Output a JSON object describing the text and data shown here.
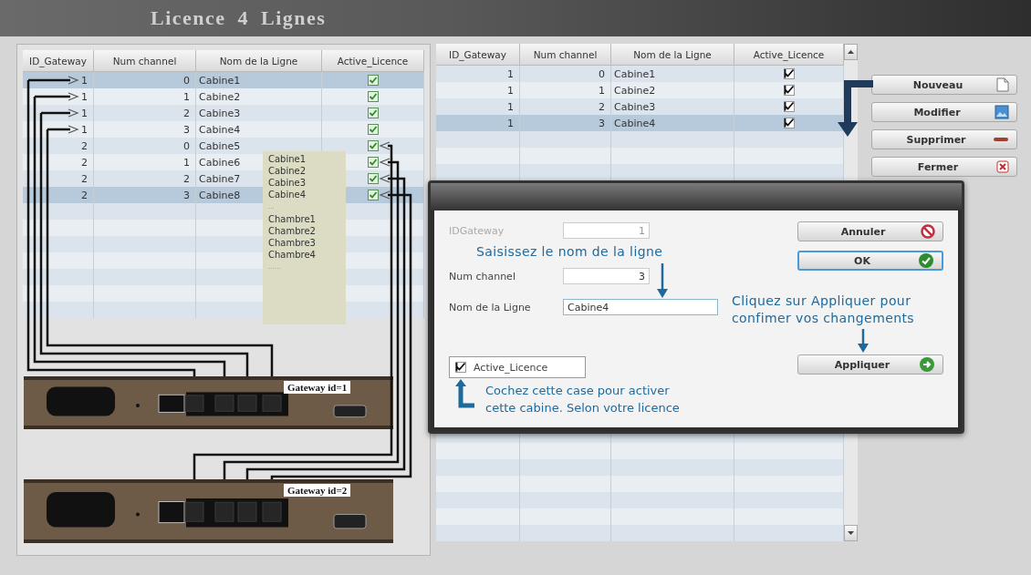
{
  "window": {
    "title": "Licence 4 Lignes"
  },
  "left_table": {
    "columns": [
      "ID_Gateway",
      "Num channel",
      "Nom de la Ligne",
      "Active_Licence"
    ],
    "rows": [
      {
        "id_gateway": "1",
        "num_channel": "0",
        "nom": "Cabine1",
        "active": true,
        "selected": true
      },
      {
        "id_gateway": "1",
        "num_channel": "1",
        "nom": "Cabine2",
        "active": true,
        "selected": false
      },
      {
        "id_gateway": "1",
        "num_channel": "2",
        "nom": "Cabine3",
        "active": true,
        "selected": false
      },
      {
        "id_gateway": "1",
        "num_channel": "3",
        "nom": "Cabine4",
        "active": true,
        "selected": false
      },
      {
        "id_gateway": "2",
        "num_channel": "0",
        "nom": "Cabine5",
        "active": true,
        "selected": false
      },
      {
        "id_gateway": "2",
        "num_channel": "1",
        "nom": "Cabine6",
        "active": true,
        "selected": false
      },
      {
        "id_gateway": "2",
        "num_channel": "2",
        "nom": "Cabine7",
        "active": true,
        "selected": false
      },
      {
        "id_gateway": "2",
        "num_channel": "3",
        "nom": "Cabine8",
        "active": true,
        "selected": true
      }
    ]
  },
  "note": {
    "lines": [
      {
        "text": "Cabine1",
        "kind": "name"
      },
      {
        "text": "Cabine2",
        "kind": "name"
      },
      {
        "text": "Cabine3",
        "kind": "name"
      },
      {
        "text": "Cabine4",
        "kind": "name"
      },
      {
        "text": "...",
        "kind": "ellipsis"
      },
      {
        "text": "Chambre1",
        "kind": "name"
      },
      {
        "text": "Chambre2",
        "kind": "name"
      },
      {
        "text": "Chambre3",
        "kind": "name"
      },
      {
        "text": "Chambre4",
        "kind": "name"
      },
      {
        "text": "......",
        "kind": "ellipsis"
      }
    ]
  },
  "gateways": [
    {
      "label": "Gateway id=1"
    },
    {
      "label": "Gateway id=2"
    }
  ],
  "right_table": {
    "columns": [
      "ID_Gateway",
      "Num channel",
      "Nom de la Ligne",
      "Active_Licence"
    ],
    "rows": [
      {
        "id_gateway": "1",
        "num_channel": "0",
        "nom": "Cabine1",
        "active": true,
        "selected": false
      },
      {
        "id_gateway": "1",
        "num_channel": "1",
        "nom": "Cabine2",
        "active": true,
        "selected": false
      },
      {
        "id_gateway": "1",
        "num_channel": "2",
        "nom": "Cabine3",
        "active": true,
        "selected": false
      },
      {
        "id_gateway": "1",
        "num_channel": "3",
        "nom": "Cabine4",
        "active": true,
        "selected": true
      }
    ]
  },
  "buttons": [
    {
      "label": "Nouveau",
      "kind": "new"
    },
    {
      "label": "Modifier",
      "kind": "edit"
    },
    {
      "label": "Supprimer",
      "kind": "delete"
    },
    {
      "label": "Fermer",
      "kind": "close"
    }
  ],
  "dialog": {
    "fields": [
      {
        "label": "IDGateway",
        "value": "1",
        "disabled": true
      },
      {
        "label": "Num channel",
        "value": "3",
        "disabled": false
      },
      {
        "label": "Nom de la Ligne",
        "value": "Cabine4",
        "disabled": false
      }
    ],
    "checkbox": {
      "label": "Active_Licence",
      "checked": true
    },
    "buttons": [
      {
        "label": "Annuler",
        "kind": "cancel",
        "focused": false
      },
      {
        "label": "OK",
        "kind": "ok",
        "focused": true
      },
      {
        "label": "Appliquer",
        "kind": "apply",
        "focused": false
      }
    ],
    "annotations": [
      {
        "text": "Saisissez le nom de la ligne"
      },
      {
        "text": "Cliquez sur Appliquer pour\nconfimer vos changements"
      },
      {
        "text": "Cochez cette case pour activer\ncette cabine. Selon votre licence"
      }
    ]
  }
}
